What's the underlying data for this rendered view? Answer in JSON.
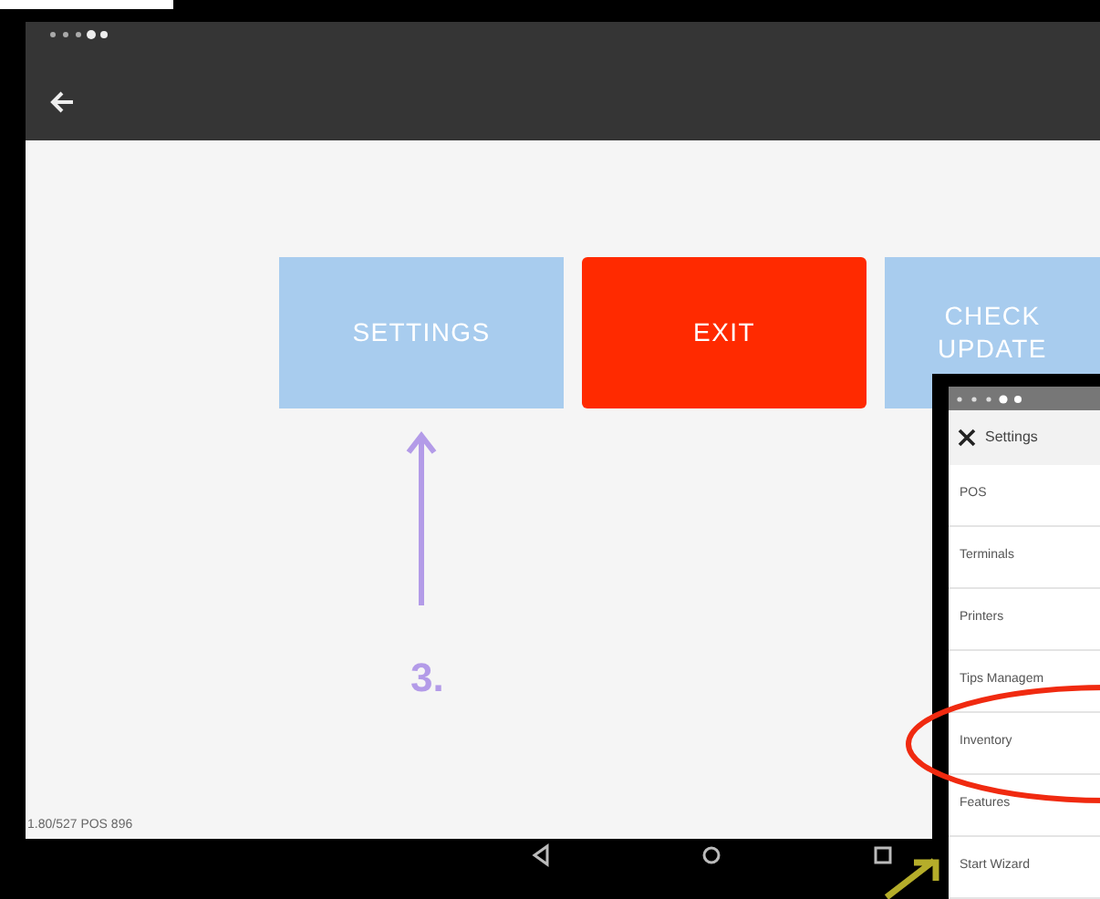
{
  "main_screen": {
    "buttons": [
      {
        "label": "SETTINGS",
        "kind": "primary"
      },
      {
        "label": "EXIT",
        "kind": "danger"
      },
      {
        "label": "CHECK UPDATE",
        "kind": "primary"
      }
    ],
    "version": "1.80/527 POS 896"
  },
  "annotation": {
    "step": "3."
  },
  "settings_panel": {
    "title": "Settings",
    "items": [
      {
        "label": "POS"
      },
      {
        "label": "Terminals"
      },
      {
        "label": "Printers"
      },
      {
        "label": "Tips Managem"
      },
      {
        "label": "Inventory",
        "circled": true
      },
      {
        "label": "Features"
      },
      {
        "label": "Start Wizard"
      }
    ]
  }
}
